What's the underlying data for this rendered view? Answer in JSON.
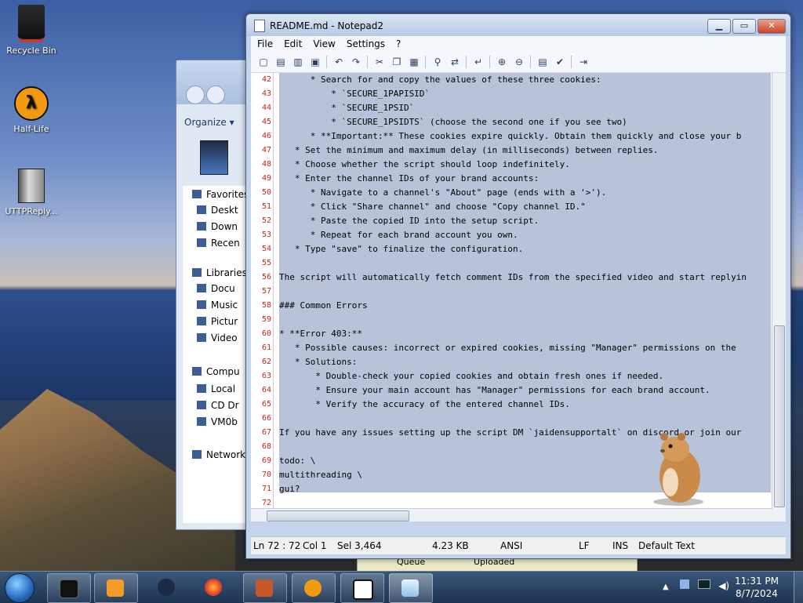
{
  "desktop": {
    "icons": [
      {
        "label": "Recycle Bin",
        "icon": "recycle-bin-icon"
      },
      {
        "label": "Half-Life",
        "icon": "half-life-icon"
      },
      {
        "label": "UTTPReply...",
        "icon": "folder-icon"
      }
    ]
  },
  "explorer": {
    "organize": "Organize ▾",
    "nav": [
      {
        "label": "Favorites"
      },
      {
        "label": "Deskt"
      },
      {
        "label": "Down"
      },
      {
        "label": "Recen"
      },
      {
        "label": "Libraries"
      },
      {
        "label": "Docu"
      },
      {
        "label": "Music"
      },
      {
        "label": "Pictur"
      },
      {
        "label": "Video"
      },
      {
        "label": "Compu"
      },
      {
        "label": "Local"
      },
      {
        "label": "CD Dr"
      },
      {
        "label": "VM0b"
      },
      {
        "label": "Network"
      }
    ]
  },
  "window": {
    "title": "README.md - Notepad2",
    "minimize": "▁",
    "maximize": "▭",
    "close": "✕"
  },
  "menu": [
    "File",
    "Edit",
    "View",
    "Settings",
    "?"
  ],
  "editor": {
    "lines": [
      {
        "n": "42",
        "text": "      * Search for and copy the values of these three cookies:"
      },
      {
        "n": "43",
        "text": "          * `SECURE_1PAPISID`"
      },
      {
        "n": "44",
        "text": "          * `SECURE_1PSID`"
      },
      {
        "n": "45",
        "text": "          * `SECURE_1PSIDTS` (choose the second one if you see two)"
      },
      {
        "n": "46",
        "text": "      * **Important:** These cookies expire quickly. Obtain them quickly and close your b"
      },
      {
        "n": "47",
        "text": "   * Set the minimum and maximum delay (in milliseconds) between replies."
      },
      {
        "n": "48",
        "text": "   * Choose whether the script should loop indefinitely."
      },
      {
        "n": "49",
        "text": "   * Enter the channel IDs of your brand accounts:"
      },
      {
        "n": "50",
        "text": "      * Navigate to a channel's \"About\" page (ends with a '>')."
      },
      {
        "n": "51",
        "text": "      * Click \"Share channel\" and choose \"Copy channel ID.\""
      },
      {
        "n": "52",
        "text": "      * Paste the copied ID into the setup script."
      },
      {
        "n": "53",
        "text": "      * Repeat for each brand account you own."
      },
      {
        "n": "54",
        "text": "   * Type \"save\" to finalize the configuration."
      },
      {
        "n": "55",
        "text": ""
      },
      {
        "n": "56",
        "text": "The script will automatically fetch comment IDs from the specified video and start replyin"
      },
      {
        "n": "57",
        "text": ""
      },
      {
        "n": "58",
        "text": "### Common Errors"
      },
      {
        "n": "59",
        "text": ""
      },
      {
        "n": "60",
        "text": "* **Error 403:**"
      },
      {
        "n": "61",
        "text": "   * Possible causes: incorrect or expired cookies, missing \"Manager\" permissions on the"
      },
      {
        "n": "62",
        "text": "   * Solutions:"
      },
      {
        "n": "63",
        "text": "       * Double-check your copied cookies and obtain fresh ones if needed."
      },
      {
        "n": "64",
        "text": "       * Ensure your main account has \"Manager\" permissions for each brand account."
      },
      {
        "n": "65",
        "text": "       * Verify the accuracy of the entered channel IDs."
      },
      {
        "n": "66",
        "text": ""
      },
      {
        "n": "67",
        "text": "If you have any issues setting up the script DM `jaidensupportalt` on discord or join our"
      },
      {
        "n": "68",
        "text": ""
      },
      {
        "n": "69",
        "text": "todo: \\"
      },
      {
        "n": "70",
        "text": "multithreading \\"
      },
      {
        "n": "71",
        "text": "gui?"
      },
      {
        "n": "72",
        "text": ""
      }
    ]
  },
  "statusbar": {
    "position": "Ln 72 : 72",
    "column": "Col 1",
    "selection": "Sel 3,464",
    "size": "4.23 KB",
    "encoding": "ANSI",
    "eol": "LF",
    "mode": "INS",
    "scheme": "Default Text"
  },
  "background_window": {
    "tab1": "Queue",
    "tab2": "Uploaded"
  },
  "taskbar": {
    "time": "11:31 PM",
    "date": "8/7/2024",
    "apps": [
      "cmd-icon",
      "media-player-icon",
      "steam-icon",
      "firefox-icon",
      "game-icon",
      "half-life-icon",
      "7zip-icon",
      "notepad2-icon"
    ]
  }
}
